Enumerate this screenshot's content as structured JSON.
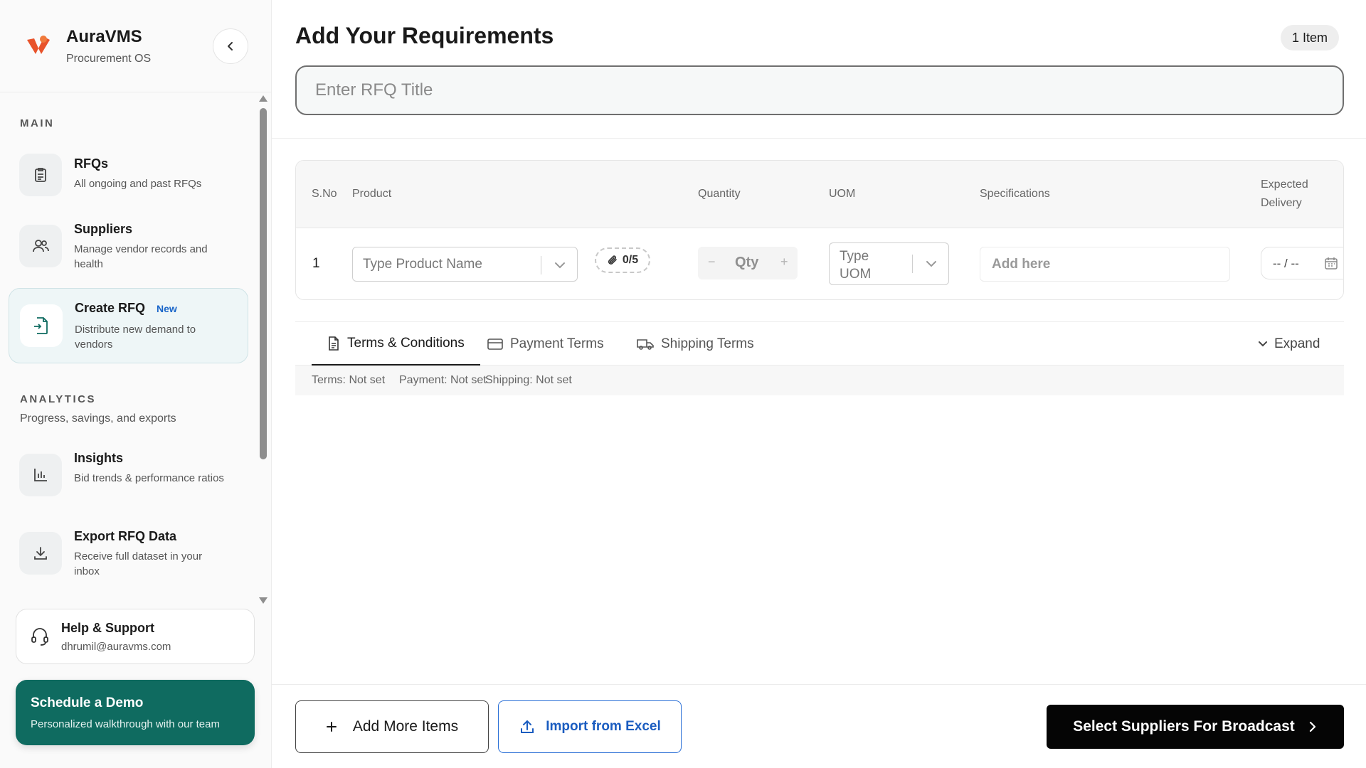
{
  "brand": {
    "name": "AuraVMS",
    "subtitle": "Procurement OS",
    "accent_color": "#e8532b"
  },
  "sidebar": {
    "main_label": "MAIN",
    "main_items": [
      {
        "title": "RFQs",
        "desc": "All ongoing and past RFQs",
        "icon": "clipboard-list-icon"
      },
      {
        "title": "Suppliers",
        "desc": "Manage vendor records and health",
        "icon": "users-icon"
      },
      {
        "title": "Create RFQ",
        "badge": "New",
        "desc": "Distribute new demand to vendors",
        "icon": "file-plus-icon",
        "active": true
      }
    ],
    "analytics_label": "ANALYTICS",
    "analytics_desc": "Progress, savings, and exports",
    "analytics_items": [
      {
        "title": "Insights",
        "desc": "Bid trends & performance ratios",
        "icon": "bar-chart-icon"
      },
      {
        "title": "Export RFQ Data",
        "desc": "Receive full dataset in your inbox",
        "icon": "download-icon"
      }
    ],
    "help": {
      "title": "Help & Support",
      "email": "dhrumil@auravms.com"
    },
    "demo": {
      "title": "Schedule a Demo",
      "subtitle": "Personalized walkthrough with our team",
      "color": "#0f6b60"
    }
  },
  "page": {
    "title": "Add Your Requirements",
    "item_count": "1 Item",
    "rfq_title_placeholder": "Enter RFQ Title"
  },
  "table": {
    "headers": {
      "sno": "S.No",
      "product": "Product",
      "quantity": "Quantity",
      "uom": "UOM",
      "specifications": "Specifications",
      "expected_delivery_line1": "Expected",
      "expected_delivery_line2": "Delivery"
    },
    "rows": [
      {
        "sno": "1",
        "product_placeholder": "Type Product Name",
        "attachments": "0/5",
        "qty_placeholder": "Qty",
        "qty_minus": "−",
        "qty_plus": "+",
        "uom_placeholder": "Type UOM",
        "spec_placeholder": "Add here",
        "date_placeholder": "-- / --"
      }
    ]
  },
  "terms_tabs": [
    {
      "label": "Terms & Conditions",
      "icon": "document-icon",
      "active": true
    },
    {
      "label": "Payment Terms",
      "icon": "credit-card-icon"
    },
    {
      "label": "Shipping Terms",
      "icon": "truck-icon"
    }
  ],
  "expand_label": "Expand",
  "terms_summary": {
    "terms": "Terms: Not set",
    "payment": "Payment: Not set",
    "shipping": "Shipping: Not set"
  },
  "footer": {
    "add_more": "Add More Items",
    "import_excel": "Import from Excel",
    "broadcast": "Select Suppliers For Broadcast"
  }
}
